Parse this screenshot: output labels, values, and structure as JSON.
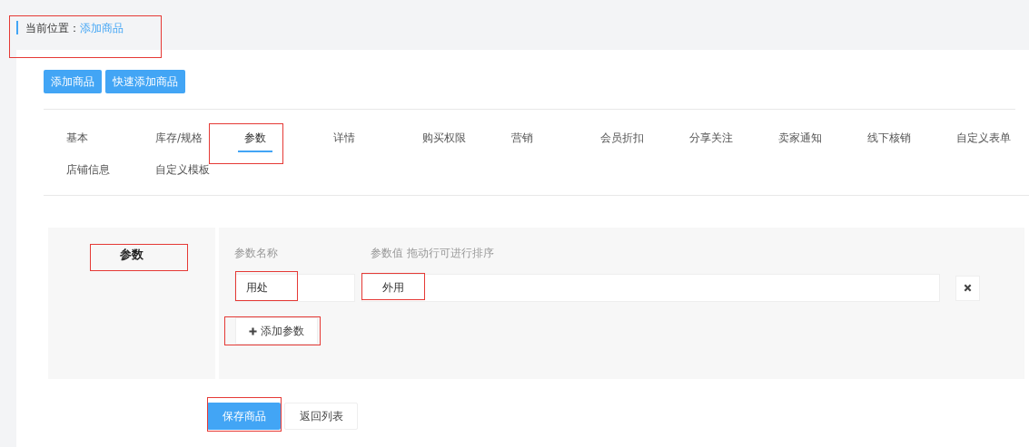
{
  "breadcrumb": {
    "label": "当前位置：",
    "current": "添加商品",
    "annotated": true
  },
  "top_buttons": [
    "添加商品",
    "快速添加商品"
  ],
  "tabs": [
    {
      "label": "基本",
      "selected": false,
      "annotated": false
    },
    {
      "label": "库存/规格",
      "selected": false,
      "annotated": false
    },
    {
      "label": "参数",
      "selected": true,
      "annotated": true
    },
    {
      "label": "详情",
      "selected": false,
      "annotated": false
    },
    {
      "label": "购买权限",
      "selected": false,
      "annotated": false
    },
    {
      "label": "营销",
      "selected": false,
      "annotated": false
    },
    {
      "label": "会员折扣",
      "selected": false,
      "annotated": false
    },
    {
      "label": "分享关注",
      "selected": false,
      "annotated": false
    },
    {
      "label": "卖家通知",
      "selected": false,
      "annotated": false
    },
    {
      "label": "线下核销",
      "selected": false,
      "annotated": false
    },
    {
      "label": "自定义表单",
      "selected": false,
      "annotated": false
    },
    {
      "label": "店铺信息",
      "selected": false,
      "annotated": false
    },
    {
      "label": "自定义模板",
      "selected": false,
      "annotated": false
    }
  ],
  "params": {
    "title": "参数",
    "title_annotated": true,
    "name_header": "参数名称",
    "value_header": "参数值 拖动行可进行排序",
    "rows": [
      {
        "name": "用处",
        "value": "外用",
        "annotated": true
      }
    ],
    "add_button": {
      "label": "添加参数",
      "annotated": true
    }
  },
  "footer_buttons": [
    {
      "label": "保存商品",
      "kind": "primary",
      "annotated": true
    },
    {
      "label": "返回列表",
      "kind": "default",
      "annotated": false
    }
  ]
}
